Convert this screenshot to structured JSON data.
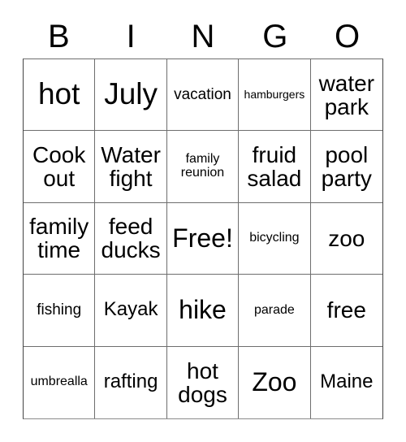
{
  "header": {
    "letters": [
      "B",
      "I",
      "N",
      "G",
      "O"
    ]
  },
  "grid": {
    "columns": 5,
    "rows": 5,
    "cells": [
      {
        "text": "hot",
        "size": "sz-xl"
      },
      {
        "text": "July",
        "size": "sz-xl"
      },
      {
        "text": "vacation",
        "size": "sz-xs"
      },
      {
        "text": "hamburgers",
        "size": "sz-tiny"
      },
      {
        "text": "water\npark",
        "size": "sz-md"
      },
      {
        "text": "Cook\nout",
        "size": "sz-md"
      },
      {
        "text": "Water\nfight",
        "size": "sz-md"
      },
      {
        "text": "family\nreunion",
        "size": "sz-xxs"
      },
      {
        "text": "fruid\nsalad",
        "size": "sz-md"
      },
      {
        "text": "pool\nparty",
        "size": "sz-md"
      },
      {
        "text": "family\ntime",
        "size": "sz-md"
      },
      {
        "text": "feed\nducks",
        "size": "sz-md"
      },
      {
        "text": "Free!",
        "size": "sz-lg"
      },
      {
        "text": "bicycling",
        "size": "sz-xxs"
      },
      {
        "text": "zoo",
        "size": "sz-md"
      },
      {
        "text": "fishing",
        "size": "sz-xs"
      },
      {
        "text": "Kayak",
        "size": "sz-sm"
      },
      {
        "text": "hike",
        "size": "sz-lg"
      },
      {
        "text": "parade",
        "size": "sz-xxs"
      },
      {
        "text": "free",
        "size": "sz-md"
      },
      {
        "text": "umbrealla",
        "size": "sz-xxs"
      },
      {
        "text": "rafting",
        "size": "sz-sm"
      },
      {
        "text": "hot\ndogs",
        "size": "sz-md"
      },
      {
        "text": "Zoo",
        "size": "sz-lg"
      },
      {
        "text": "Maine",
        "size": "sz-sm"
      }
    ]
  },
  "colors": {
    "background": "#ffffff",
    "text": "#000000",
    "grid_line": "#6e6e6e",
    "grid_border": "#444444"
  }
}
